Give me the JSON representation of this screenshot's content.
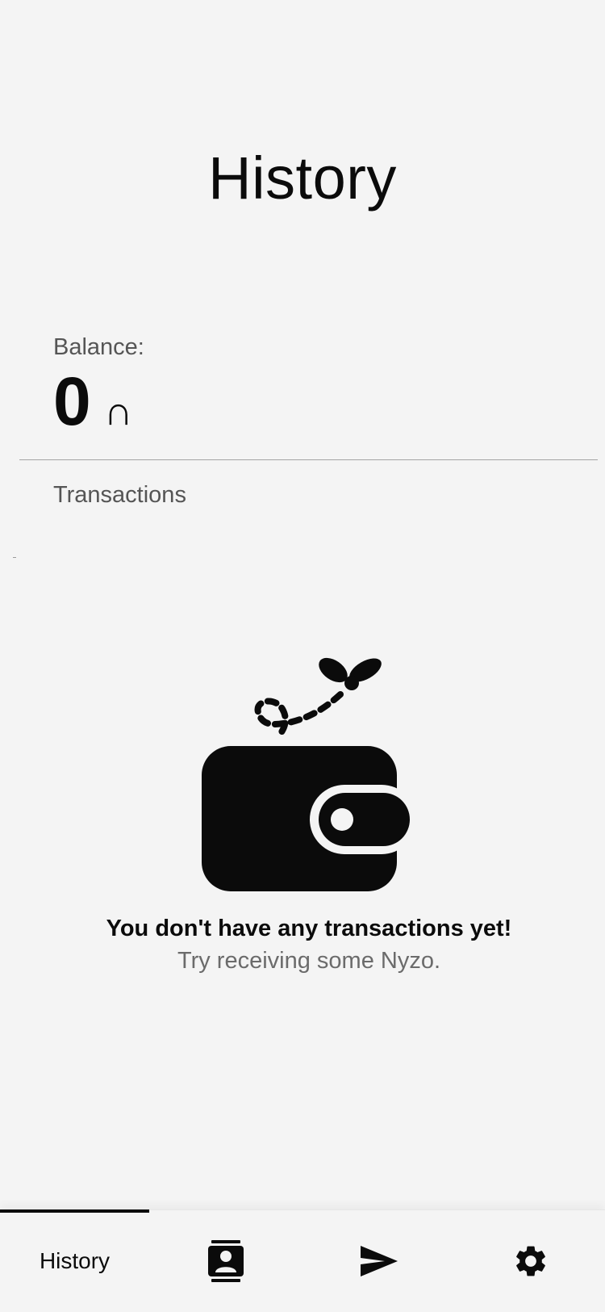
{
  "header": {
    "title": "History"
  },
  "balance": {
    "label": "Balance:",
    "value": "0",
    "currency_symbol": "∩"
  },
  "transactions": {
    "heading": "Transactions",
    "empty_state": {
      "icon": "wallet-icon",
      "title": "You don't have any transactions yet!",
      "subtitle": "Try receiving some Nyzo."
    }
  },
  "bottom_nav": {
    "active_index": 0,
    "items": [
      {
        "label": "History",
        "icon": "history-tab"
      },
      {
        "icon": "contacts-icon"
      },
      {
        "icon": "send-icon"
      },
      {
        "icon": "settings-icon"
      }
    ]
  },
  "colors": {
    "background": "#f4f4f4",
    "text_primary": "#0b0b0b",
    "text_secondary": "#555555",
    "text_muted": "#6b6b6b",
    "divider": "#a4a4a4"
  }
}
